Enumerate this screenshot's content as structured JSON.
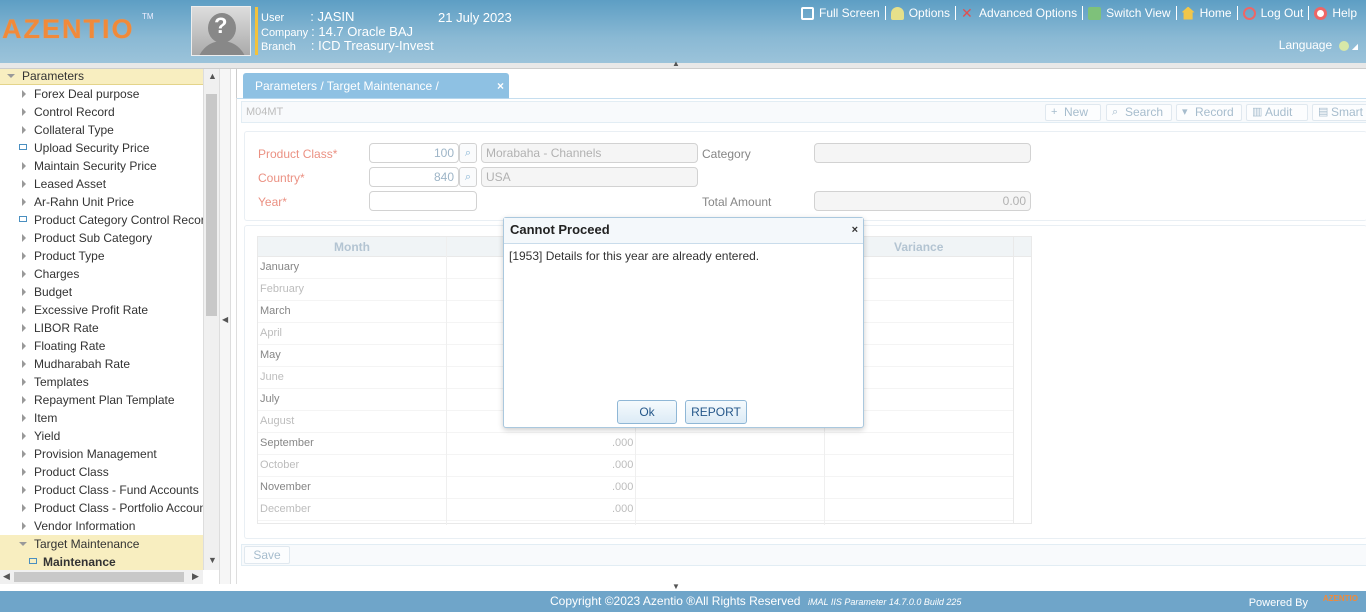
{
  "header": {
    "logo": "AZENTIO",
    "logo_tm": "TM",
    "user_label": "User",
    "user_value": ": JASIN",
    "company_label": "Company",
    "company_value": ": 14.7 Oracle BAJ",
    "branch_label": "Branch",
    "branch_value": ": ICD Treasury-Invest",
    "date": "21 July 2023",
    "tools": [
      "Full Screen",
      "Options",
      "Advanced Options",
      "Switch View",
      "Home",
      "Log Out",
      "Help"
    ],
    "language": "Language"
  },
  "sidebar": {
    "root": "Parameters",
    "items": [
      {
        "label": "Forex Deal purpose",
        "type": "folder"
      },
      {
        "label": "Control Record",
        "type": "folder"
      },
      {
        "label": "Collateral Type",
        "type": "folder"
      },
      {
        "label": "Upload Security Price",
        "type": "leaf"
      },
      {
        "label": "Maintain Security Price",
        "type": "folder"
      },
      {
        "label": "Leased Asset",
        "type": "folder"
      },
      {
        "label": "Ar-Rahn Unit Price",
        "type": "folder"
      },
      {
        "label": "Product Category Control Record",
        "type": "leaf"
      },
      {
        "label": "Product Sub Category",
        "type": "folder"
      },
      {
        "label": "Product Type",
        "type": "folder"
      },
      {
        "label": "Charges",
        "type": "folder"
      },
      {
        "label": "Budget",
        "type": "folder"
      },
      {
        "label": "Excessive Profit Rate",
        "type": "folder"
      },
      {
        "label": "LIBOR Rate",
        "type": "folder"
      },
      {
        "label": "Floating Rate",
        "type": "folder"
      },
      {
        "label": "Mudharabah Rate",
        "type": "folder"
      },
      {
        "label": "Templates",
        "type": "folder"
      },
      {
        "label": "Repayment Plan Template",
        "type": "folder"
      },
      {
        "label": "Item",
        "type": "folder"
      },
      {
        "label": "Yield",
        "type": "folder"
      },
      {
        "label": "Provision Management",
        "type": "folder"
      },
      {
        "label": "Product Class",
        "type": "folder"
      },
      {
        "label": "Product Class - Fund Accounts",
        "type": "folder"
      },
      {
        "label": "Product Class - Portfolio Accounts",
        "type": "folder"
      },
      {
        "label": "Vendor Information",
        "type": "folder"
      },
      {
        "label": "Target Maintenance",
        "type": "open"
      },
      {
        "label": "Maintenance",
        "type": "sub"
      }
    ]
  },
  "tab": {
    "label": "Parameters / Target Maintenance / Maintenance",
    "close": "×"
  },
  "screen_code": "M04MT",
  "actions": [
    "New",
    "Search",
    "Record",
    "Audit",
    "Smart"
  ],
  "form": {
    "product_class_label": "Product Class*",
    "product_class_value": "100",
    "product_class_desc": "Morabaha - Channels",
    "country_label": "Country*",
    "country_value": "840",
    "country_desc": "USA",
    "year_label": "Year*",
    "year_value": "",
    "category_label": "Category",
    "category_value": "",
    "total_amount_label": "Total Amount",
    "total_amount_value": "0.00"
  },
  "grid": {
    "columns": [
      "Month",
      "T",
      "",
      "Variance"
    ],
    "rows": [
      {
        "month": "January",
        "target": ""
      },
      {
        "month": "February",
        "target": ""
      },
      {
        "month": "March",
        "target": ""
      },
      {
        "month": "April",
        "target": ""
      },
      {
        "month": "May",
        "target": ""
      },
      {
        "month": "June",
        "target": ""
      },
      {
        "month": "July",
        "target": ""
      },
      {
        "month": "August",
        "target": ".000"
      },
      {
        "month": "September",
        "target": ".000"
      },
      {
        "month": "October",
        "target": ".000"
      },
      {
        "month": "November",
        "target": ".000"
      },
      {
        "month": "December",
        "target": ".000"
      }
    ]
  },
  "save_label": "Save",
  "dialog": {
    "title": "Cannot Proceed",
    "close": "×",
    "message": "[1953] Details for this year are already entered.",
    "ok": "Ok",
    "report": "REPORT"
  },
  "footer": {
    "copyright": "Copyright ©2023 Azentio ®All Rights Reserved",
    "build": "iMAL IIS Parameter 14.7.0.0 Build 225",
    "powered_by": "Powered By",
    "powered_logo": "AZENTIO"
  },
  "colors": {
    "accent": "#6fa5c9",
    "required": "#e0553f",
    "tab": "#8ec1e3",
    "brand": "#f08a3a"
  }
}
